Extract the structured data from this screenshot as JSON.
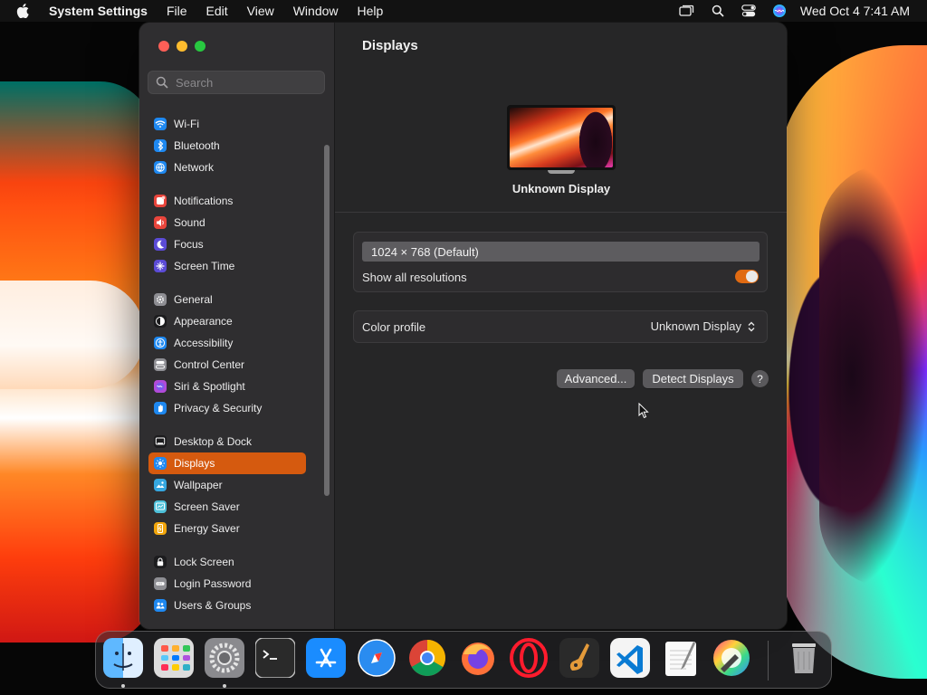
{
  "menubar": {
    "app_name": "System Settings",
    "menus": [
      "File",
      "Edit",
      "View",
      "Window",
      "Help"
    ],
    "clock": "Wed Oct 4  7:41 AM",
    "status_icons": [
      "screen-mirroring-icon",
      "spotlight-search-icon",
      "control-center-icon",
      "siri-icon"
    ]
  },
  "sidebar": {
    "search_placeholder": "Search",
    "groups": [
      [
        {
          "label": "Wi-Fi",
          "icon": "wifi-icon",
          "color": "#1e88f0"
        },
        {
          "label": "Bluetooth",
          "icon": "bluetooth-icon",
          "color": "#1e88f0"
        },
        {
          "label": "Network",
          "icon": "network-globe-icon",
          "color": "#1e88f0"
        }
      ],
      [
        {
          "label": "Notifications",
          "icon": "notifications-icon",
          "color": "#e8453c"
        },
        {
          "label": "Sound",
          "icon": "sound-icon",
          "color": "#e8453c"
        },
        {
          "label": "Focus",
          "icon": "focus-moon-icon",
          "color": "#5b4bd6"
        },
        {
          "label": "Screen Time",
          "icon": "screen-time-icon",
          "color": "#5b4bd6"
        }
      ],
      [
        {
          "label": "General",
          "icon": "general-gear-icon",
          "color": "#8e8e93"
        },
        {
          "label": "Appearance",
          "icon": "appearance-icon",
          "color": "#1c1c1e"
        },
        {
          "label": "Accessibility",
          "icon": "accessibility-icon",
          "color": "#1e88f0"
        },
        {
          "label": "Control Center",
          "icon": "control-center-icon",
          "color": "#8e8e93"
        },
        {
          "label": "Siri & Spotlight",
          "icon": "siri-icon",
          "color": "#b04ad8"
        },
        {
          "label": "Privacy & Security",
          "icon": "privacy-hand-icon",
          "color": "#1e88f0"
        }
      ],
      [
        {
          "label": "Desktop & Dock",
          "icon": "desktop-dock-icon",
          "color": "#1c1c1e"
        },
        {
          "label": "Displays",
          "icon": "displays-icon",
          "color": "#1e88f0",
          "selected": true
        },
        {
          "label": "Wallpaper",
          "icon": "wallpaper-icon",
          "color": "#35a7e0"
        },
        {
          "label": "Screen Saver",
          "icon": "screen-saver-icon",
          "color": "#4dc0d9"
        },
        {
          "label": "Energy Saver",
          "icon": "energy-saver-icon",
          "color": "#f2a60c"
        }
      ],
      [
        {
          "label": "Lock Screen",
          "icon": "lock-icon",
          "color": "#1c1c1e"
        },
        {
          "label": "Login Password",
          "icon": "login-password-icon",
          "color": "#8e8e93"
        },
        {
          "label": "Users & Groups",
          "icon": "users-groups-icon",
          "color": "#1e88f0"
        }
      ]
    ]
  },
  "main": {
    "title": "Displays",
    "display_name": "Unknown Display",
    "resolution": "1024 × 768 (Default)",
    "show_all_label": "Show all resolutions",
    "show_all_on": true,
    "color_profile_label": "Color profile",
    "color_profile_value": "Unknown Display",
    "advanced_button": "Advanced...",
    "detect_button": "Detect Displays",
    "help_button": "?"
  },
  "dock": {
    "apps": [
      {
        "name": "finder-icon",
        "running": true
      },
      {
        "name": "launchpad-icon",
        "running": false
      },
      {
        "name": "system-settings-icon",
        "running": true
      },
      {
        "name": "terminal-icon",
        "running": false
      },
      {
        "name": "app-store-icon",
        "running": false
      },
      {
        "name": "safari-icon",
        "running": false
      },
      {
        "name": "chrome-icon",
        "running": false
      },
      {
        "name": "firefox-icon",
        "running": false
      },
      {
        "name": "opera-icon",
        "running": false
      },
      {
        "name": "garageband-icon",
        "running": false
      },
      {
        "name": "vscode-icon",
        "running": false
      },
      {
        "name": "textedit-icon",
        "running": false
      },
      {
        "name": "color-picker-icon",
        "running": false
      },
      {
        "name": "trash-icon",
        "running": false
      }
    ]
  },
  "colors": {
    "accent": "#d55a0f",
    "toggle_on": "#e06a12",
    "window_bg": "#262627",
    "sidebar_bg": "#2f2e30"
  }
}
